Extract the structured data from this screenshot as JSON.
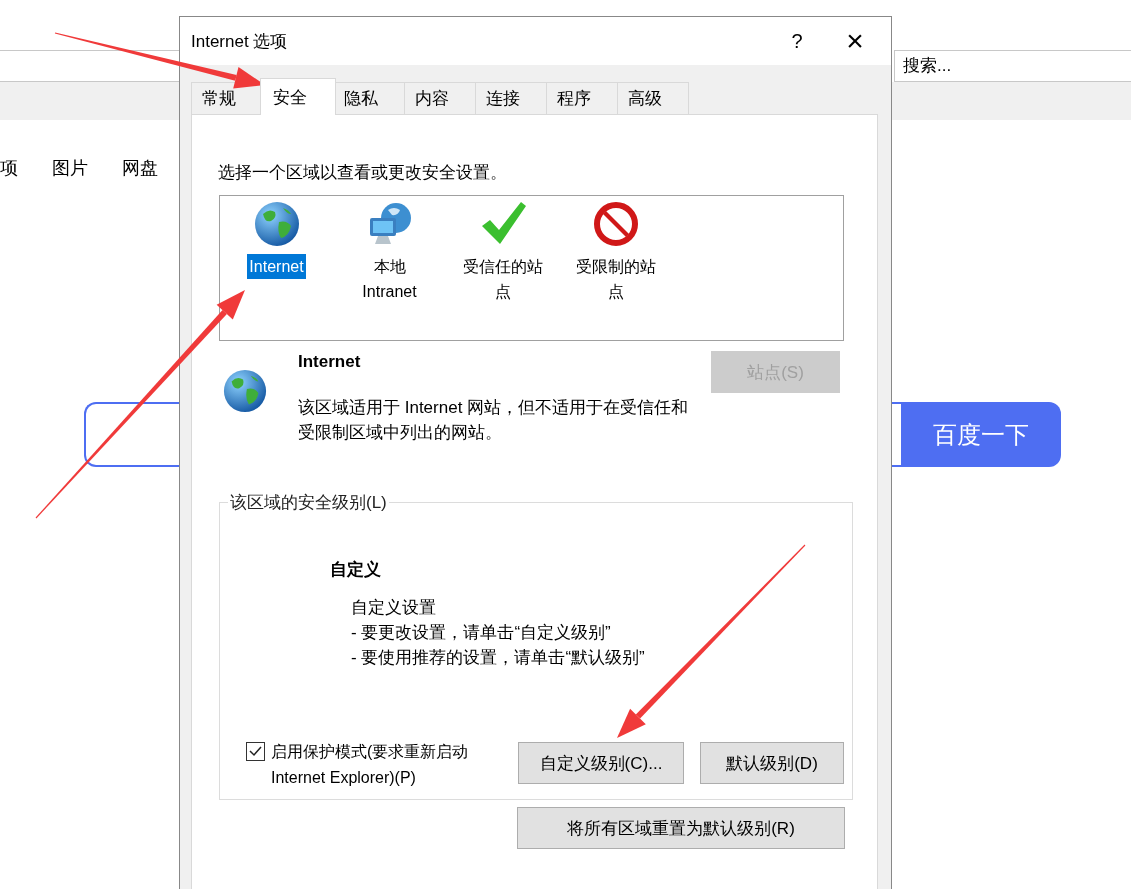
{
  "browser": {
    "search_box": {
      "placeholder": "搜索..."
    },
    "nav_links": [
      "项",
      "图片",
      "网盘"
    ],
    "baidu_search": {
      "button": "百度一下"
    }
  },
  "dialog": {
    "title": "Internet 选项",
    "help": "?",
    "close": "×",
    "tabs": [
      {
        "label": "常规",
        "selected": false
      },
      {
        "label": "安全",
        "selected": true
      },
      {
        "label": "隐私",
        "selected": false
      },
      {
        "label": "内容",
        "selected": false
      },
      {
        "label": "连接",
        "selected": false
      },
      {
        "label": "程序",
        "selected": false
      },
      {
        "label": "高级",
        "selected": false
      }
    ],
    "zone_prompt": "选择一个区域以查看或更改安全设置。",
    "zones": [
      {
        "kind": "globe",
        "label": "Internet",
        "selected": true
      },
      {
        "kind": "network",
        "label": "本地 Intranet",
        "selected": false
      },
      {
        "kind": "check",
        "label": "受信任的站点",
        "selected": false
      },
      {
        "kind": "block",
        "label": "受限制的站点",
        "selected": false
      }
    ],
    "zone_info": {
      "title": "Internet",
      "description": "该区域适用于 Internet 网站，但不适用于在受信任和受限制区域中列出的网站。",
      "sites_button": {
        "label": "站点(S)",
        "disabled": true
      }
    },
    "security_level": {
      "legend": "该区域的安全级别(L)",
      "level_name": "自定义",
      "lines": [
        "自定义设置",
        "- 要更改设置，请单击“自定义级别”",
        "- 要使用推荐的设置，请单击“默认级别”"
      ],
      "protected_mode": {
        "label": "启用保护模式(要求重新启动 Internet Explorer)(P)",
        "checked": true
      },
      "buttons": [
        "自定义级别(C)...",
        "默认级别(D)"
      ]
    },
    "reset_button": "将所有区域重置为默认级别(R)"
  }
}
